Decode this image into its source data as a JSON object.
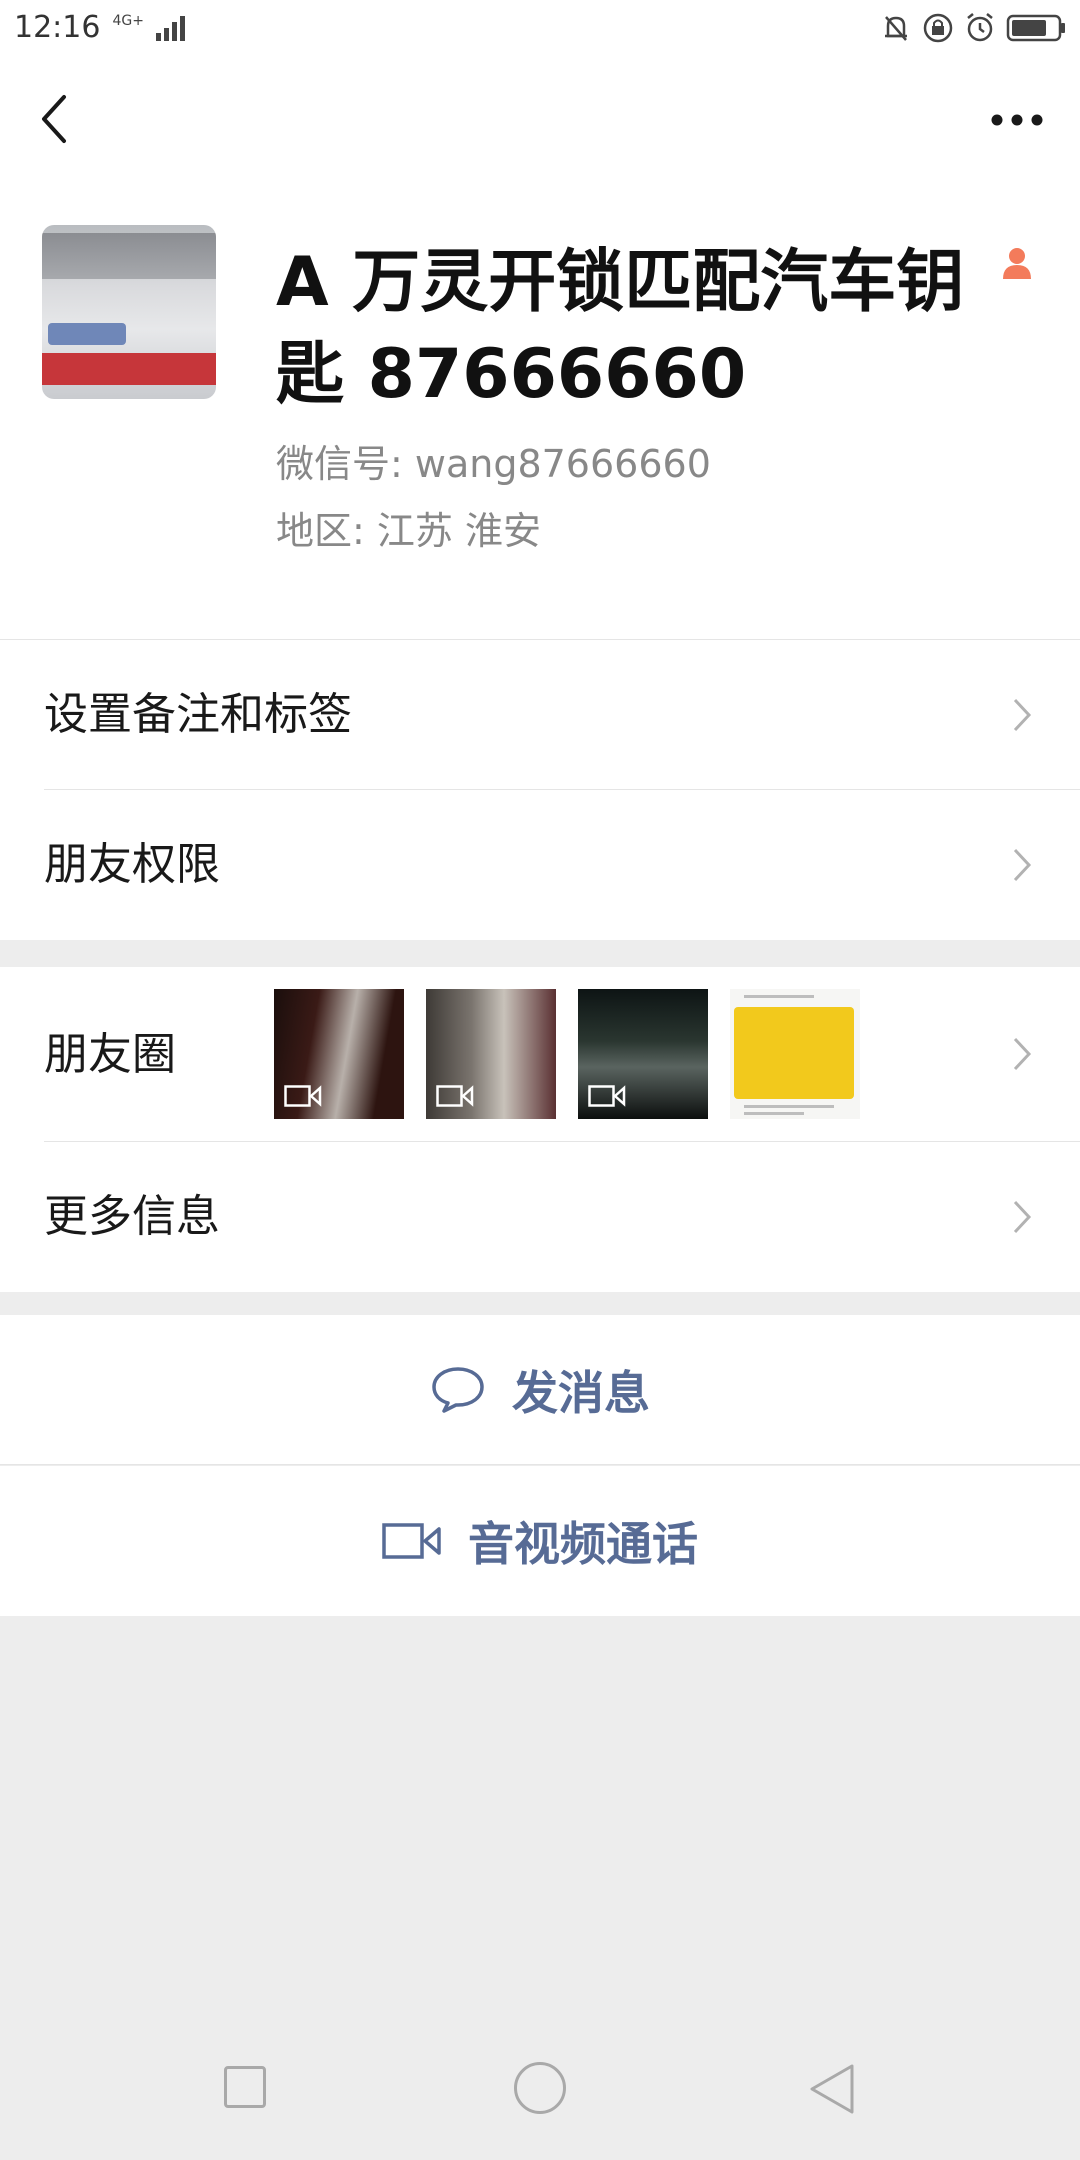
{
  "status_bar": {
    "time": "12:16",
    "network": "4G+"
  },
  "header": {
    "back_icon": "chevron-left-icon",
    "more_icon": "more-dots-icon"
  },
  "profile": {
    "name": "A  万灵开锁匹配汽车钥匙 87666660",
    "wechat_id": "微信号: wang87666660",
    "region": "地区: 江苏  淮安"
  },
  "menu": {
    "remark_tags": "设置备注和标签",
    "friend_permissions": "朋友权限",
    "moments": "朋友圈",
    "more_info": "更多信息"
  },
  "actions": {
    "send_message": "发消息",
    "av_call": "音视频通话"
  },
  "colors": {
    "link": "#576b95",
    "background": "#ededed",
    "gender_female": "#f37b5b"
  }
}
